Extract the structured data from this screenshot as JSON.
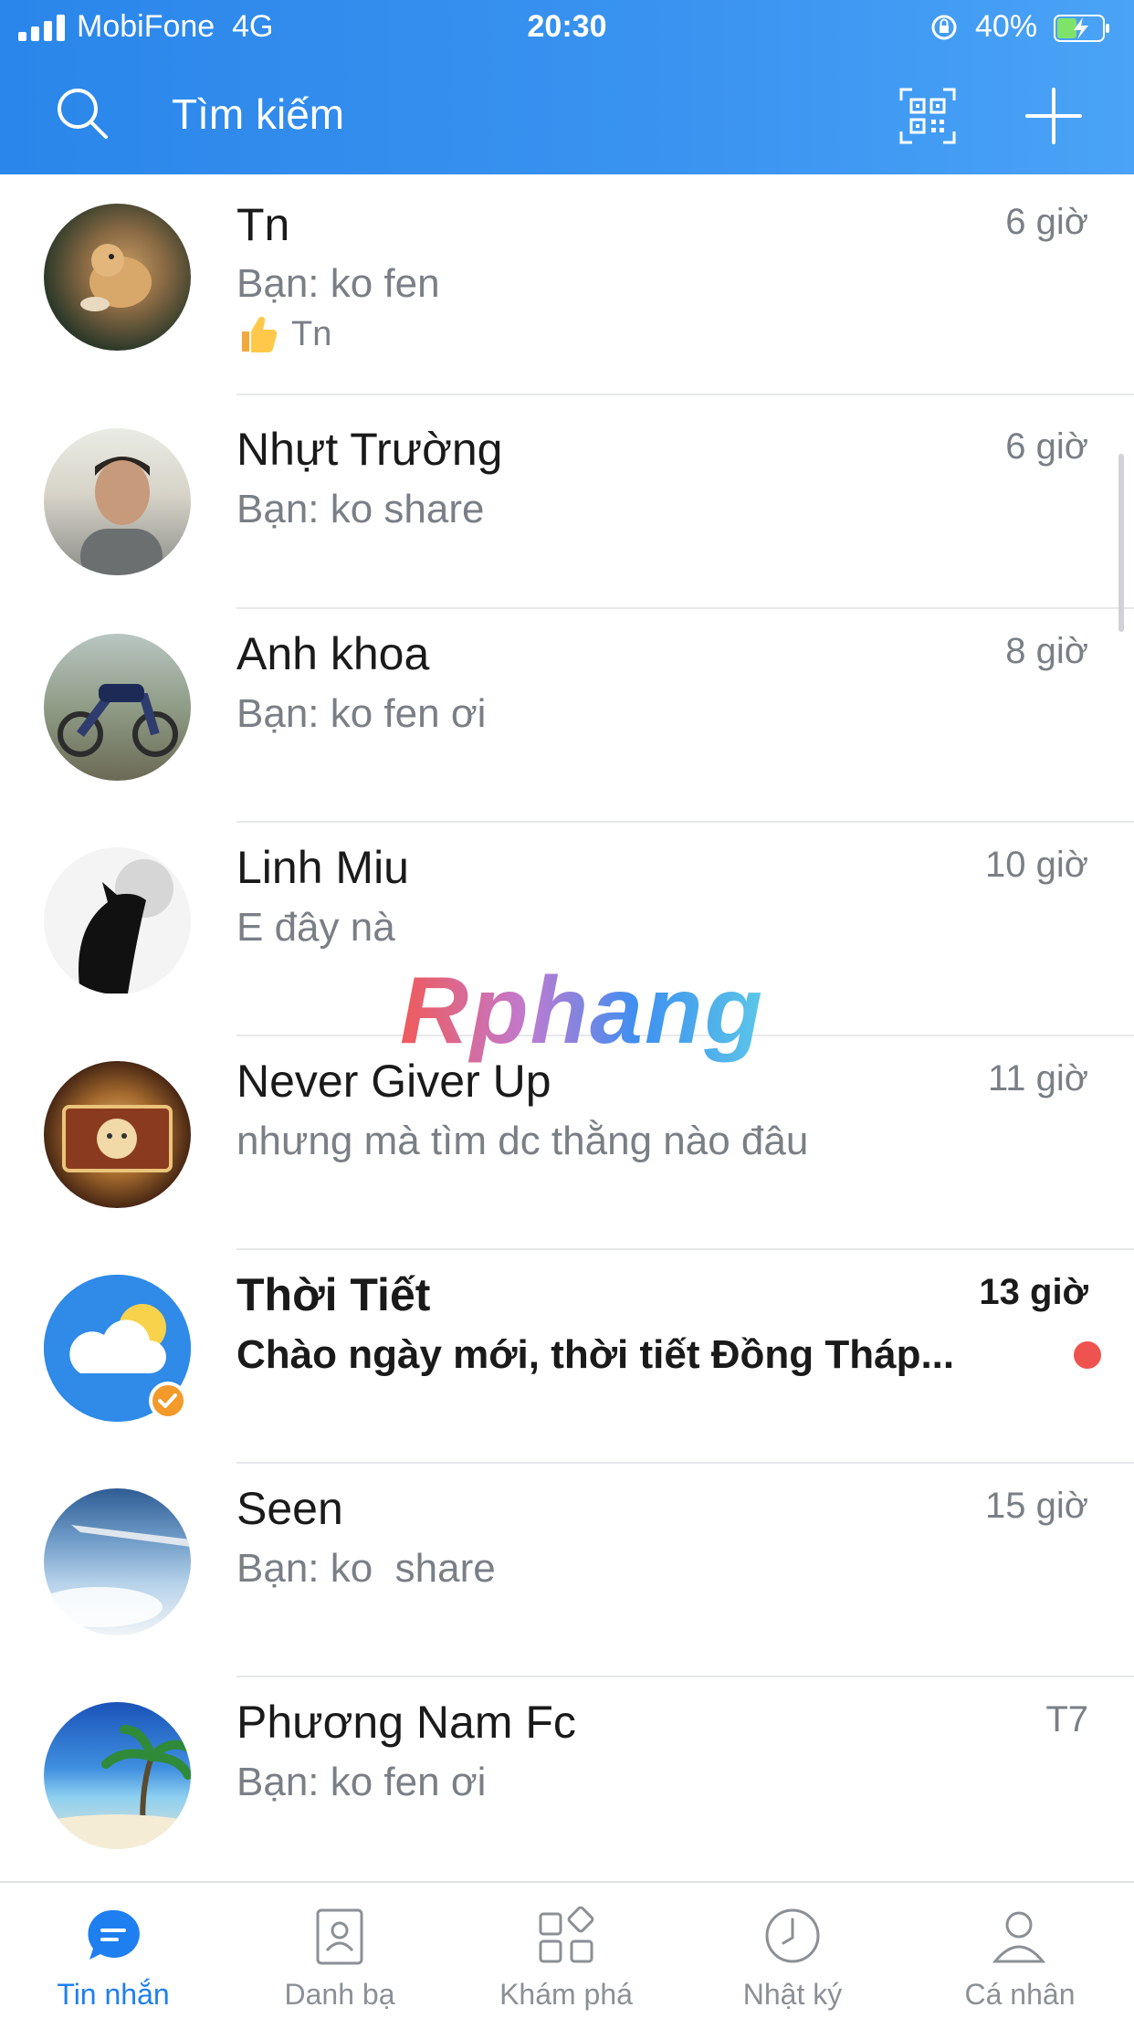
{
  "status_bar": {
    "carrier": "MobiFone",
    "network": "4G",
    "time": "20:30",
    "battery": "40%"
  },
  "header": {
    "search_placeholder": "Tìm kiếm",
    "qr_icon": "qr-code-icon",
    "add_icon": "plus-icon"
  },
  "conversations": [
    {
      "name": "Tn",
      "message": "Bạn: ko fen",
      "time": "6 giờ",
      "reaction": "Tn",
      "bold": false
    },
    {
      "name": "Nhựt Trường",
      "message": "Bạn: ko share",
      "time": "6 giờ",
      "bold": false
    },
    {
      "name": "Anh khoa",
      "message": "Bạn: ko fen ơi",
      "time": "8 giờ",
      "bold": false
    },
    {
      "name": "Linh Miu",
      "message": "E đây nà",
      "time": "10 giờ",
      "bold": false
    },
    {
      "name": "Never Giver Up",
      "message": "nhưng mà tìm dc thằng nào đâu",
      "time": "11 giờ",
      "bold": false
    },
    {
      "name": "Thời Tiết",
      "message": "Chào ngày mới, thời tiết Đồng Tháp...",
      "time": "13 giờ",
      "bold": true
    },
    {
      "name": "Seen",
      "message": "Bạn: ko  share",
      "time": "15 giờ",
      "bold": false
    },
    {
      "name": "Phương Nam Fc",
      "message": "Bạn: ko fen ơi",
      "time": "T7",
      "bold": false
    }
  ],
  "watermark": "Rphang",
  "bottom_nav": [
    {
      "label": "Tin nhắn",
      "icon": "chat-bubble-icon",
      "active": true
    },
    {
      "label": "Danh bạ",
      "icon": "contacts-icon",
      "active": false
    },
    {
      "label": "Khám phá",
      "icon": "discover-icon",
      "active": false
    },
    {
      "label": "Nhật ký",
      "icon": "clock-icon",
      "active": false
    },
    {
      "label": "Cá nhân",
      "icon": "person-icon",
      "active": false
    }
  ],
  "colors": {
    "header_blue": "#2a86ea",
    "active_tab": "#1e7ff0",
    "unread_dot": "#ef5350"
  }
}
